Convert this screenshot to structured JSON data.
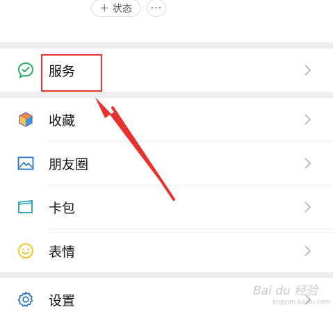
{
  "top": {
    "status_label": "＋ 状态",
    "more_label": "···"
  },
  "menu": {
    "items": [
      {
        "label": "服务"
      },
      {
        "label": "收藏"
      },
      {
        "label": "朋友圈"
      },
      {
        "label": "卡包"
      },
      {
        "label": "表情"
      },
      {
        "label": "设置"
      }
    ]
  },
  "watermark": {
    "text": "Bai du 经验",
    "sub": "jingyan.baidu.com"
  },
  "colors": {
    "gap": "#ededed",
    "service_icon": "#2bae67",
    "callout": "#e8322f",
    "image_icon": "#1f6fc5",
    "emoji_icon": "#f4c21a"
  }
}
